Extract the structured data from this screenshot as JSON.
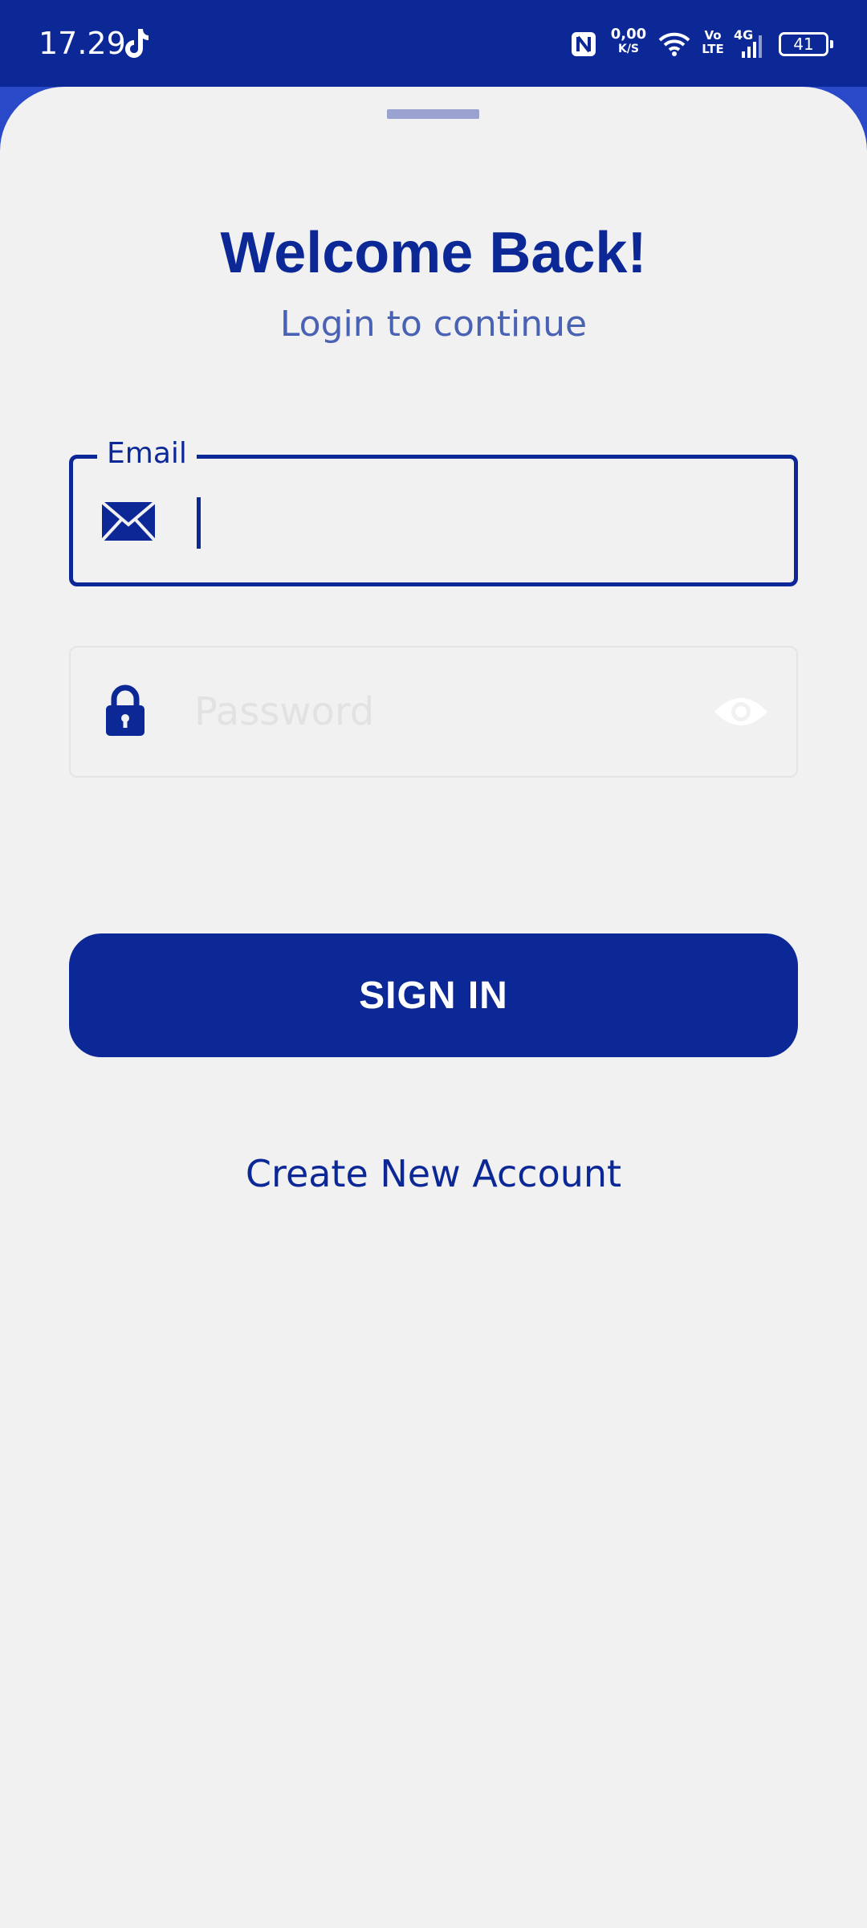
{
  "status_bar": {
    "time": "17.29",
    "network_speed_value": "0,00",
    "network_speed_unit": "K/S",
    "volte_top": "Vo",
    "volte_bottom": "LTE",
    "network_type": "4G",
    "battery_level": "41",
    "icons": [
      "tiktok-icon",
      "nfc-icon",
      "wifi-icon",
      "signal-icon",
      "battery-icon"
    ]
  },
  "login": {
    "title": "Welcome Back!",
    "subtitle": "Login to continue",
    "email": {
      "label": "Email",
      "value": "",
      "icon": "mail-icon"
    },
    "password": {
      "placeholder": "Password",
      "value": "",
      "icon": "lock-icon",
      "toggle_icon": "eye-icon"
    },
    "sign_in_label": "SIGN IN",
    "create_account_label": "Create New Account"
  },
  "colors": {
    "primary": "#0b2896",
    "background": "#f1f1f1",
    "subtitle": "#4a62b3",
    "handle": "#9aa3cf"
  }
}
